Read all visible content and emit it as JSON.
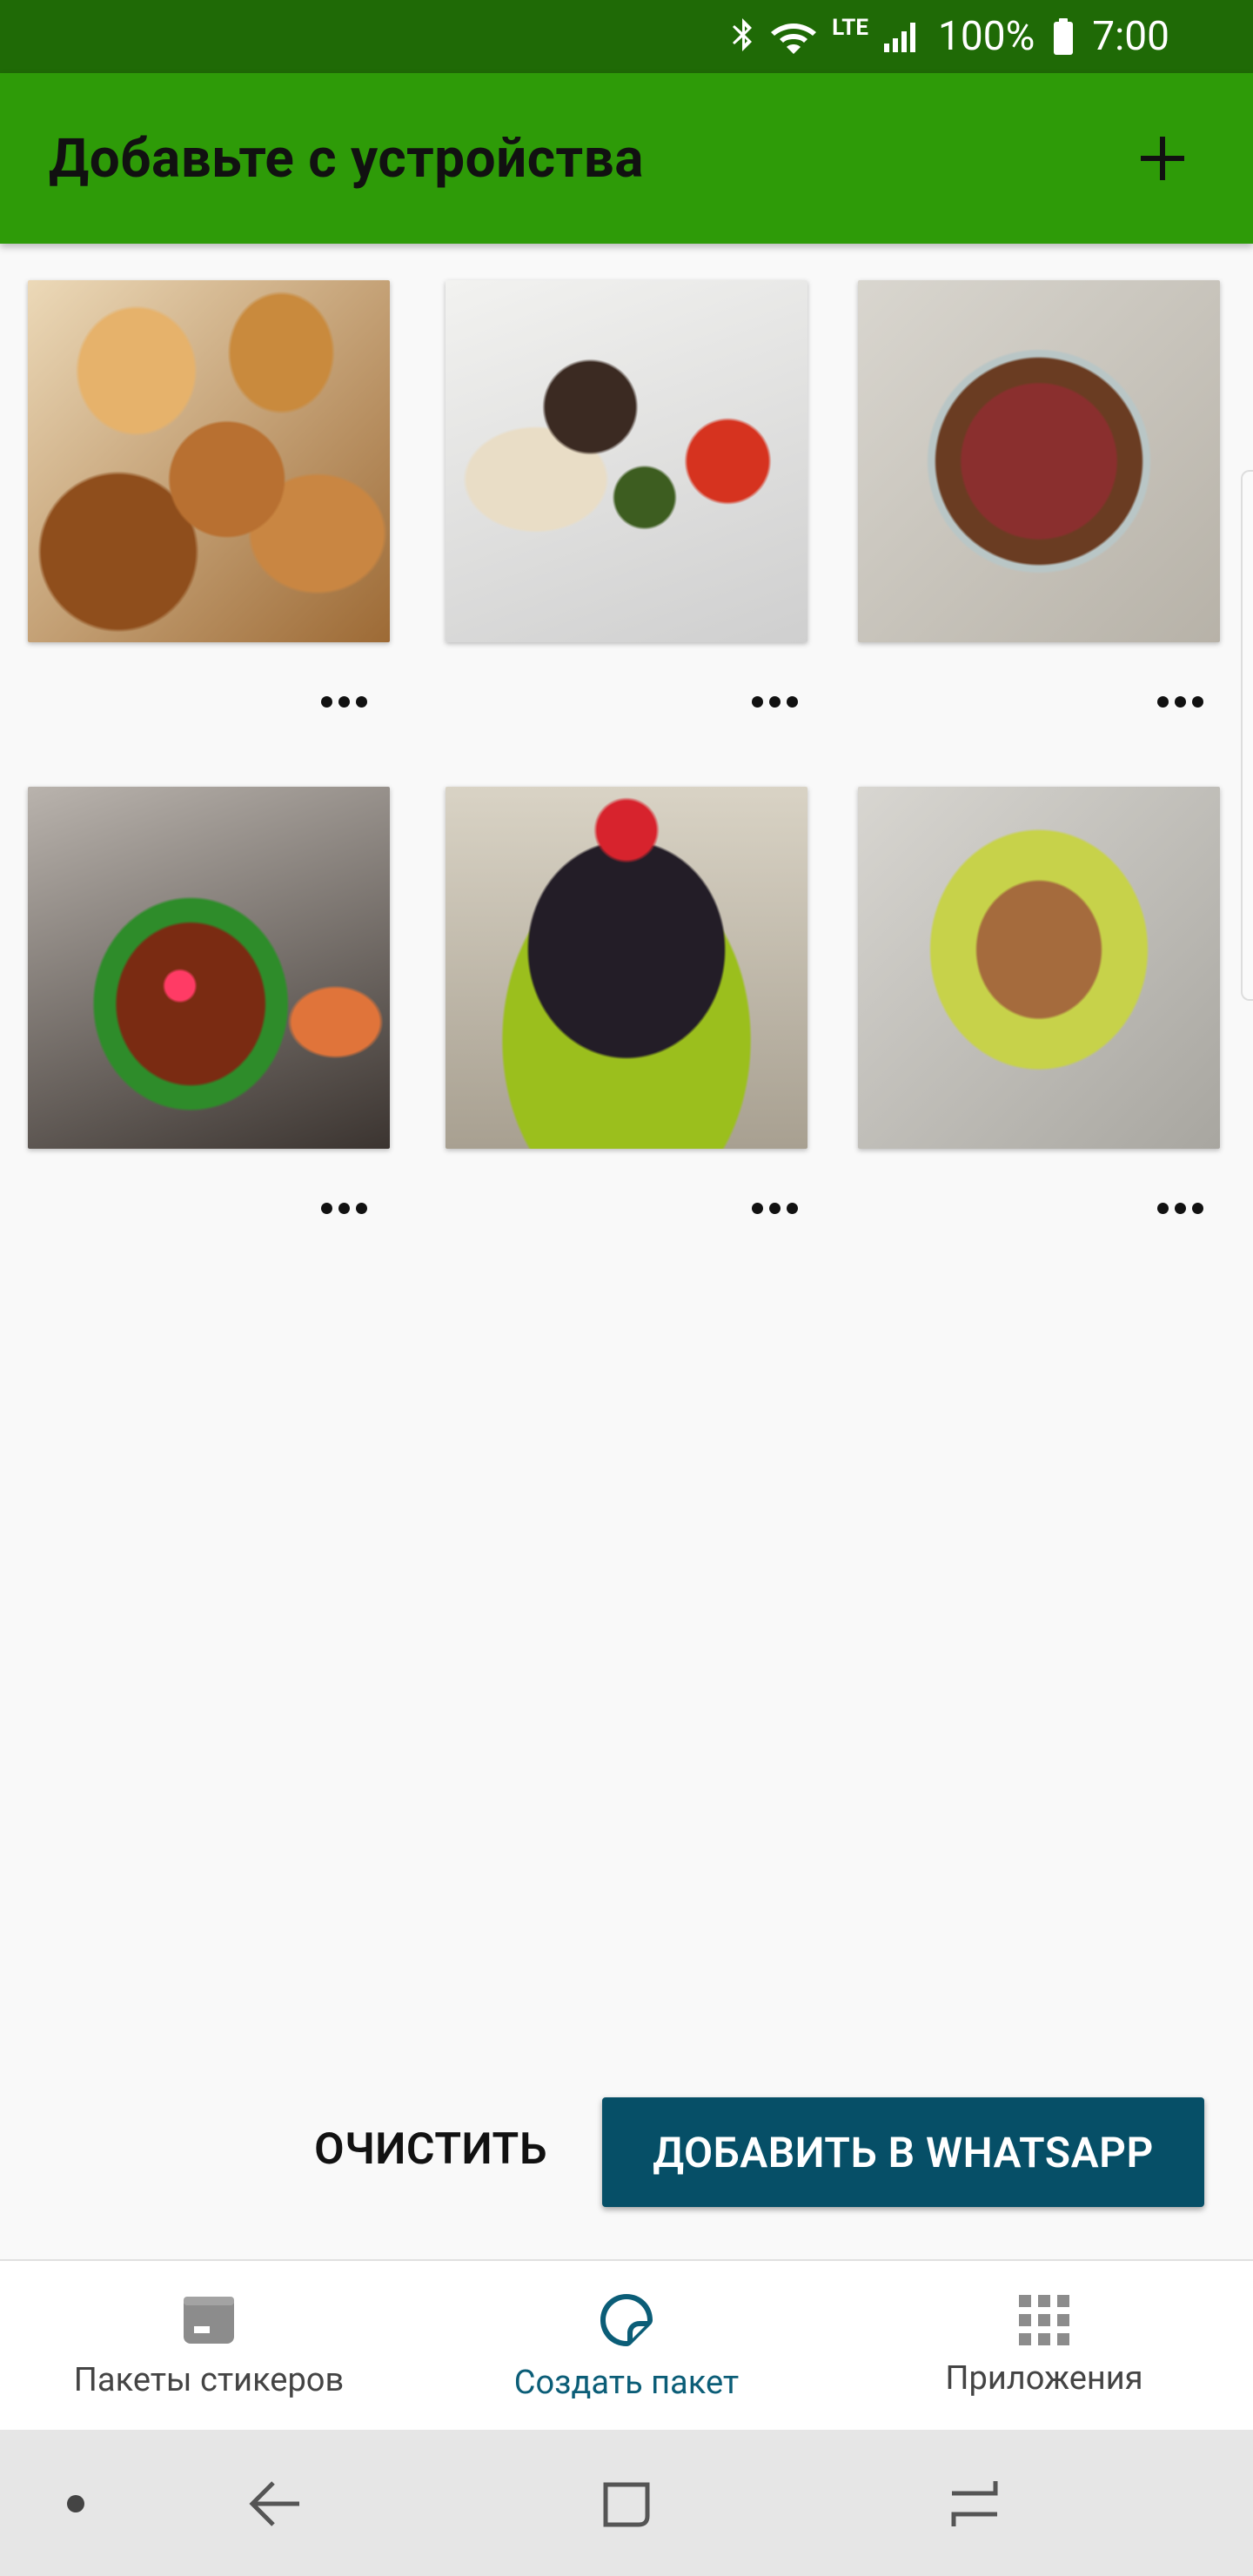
{
  "status_bar": {
    "network": "LTE",
    "battery_percent": "100%",
    "time": "7:00",
    "icons": [
      "bluetooth-icon",
      "wifi-icon",
      "lte-icon",
      "signal-icon",
      "battery-icon"
    ]
  },
  "app_bar": {
    "title": "Добавьте с устройства",
    "action_icon": "plus-icon",
    "background_color": "#2e9b08",
    "status_color": "#1f6a06"
  },
  "stickers": [
    {
      "name": "stickers-1",
      "menu_icon": "more-horiz-icon"
    },
    {
      "name": "stickers-2",
      "menu_icon": "more-horiz-icon"
    },
    {
      "name": "stickers-3",
      "menu_icon": "more-horiz-icon"
    },
    {
      "name": "stickers-4",
      "menu_icon": "more-horiz-icon"
    },
    {
      "name": "stickers-5",
      "menu_icon": "more-horiz-icon"
    },
    {
      "name": "stickers-6",
      "menu_icon": "more-horiz-icon"
    }
  ],
  "actions": {
    "clear_label": "ОЧИСТИТЬ",
    "add_label": "ДОБАВИТЬ В WHATSAPP",
    "accent_color": "#064f67"
  },
  "bottom_nav": {
    "items": [
      {
        "label": "Пакеты стикеров",
        "icon": "sticker-pack-icon",
        "active": false
      },
      {
        "label": "Создать пакет",
        "icon": "create-sticker-icon",
        "active": true
      },
      {
        "label": "Приложения",
        "icon": "apps-grid-icon",
        "active": false
      }
    ]
  },
  "system_nav": {
    "buttons": [
      "dot-icon",
      "back-icon",
      "home-icon",
      "recent-apps-icon"
    ]
  }
}
